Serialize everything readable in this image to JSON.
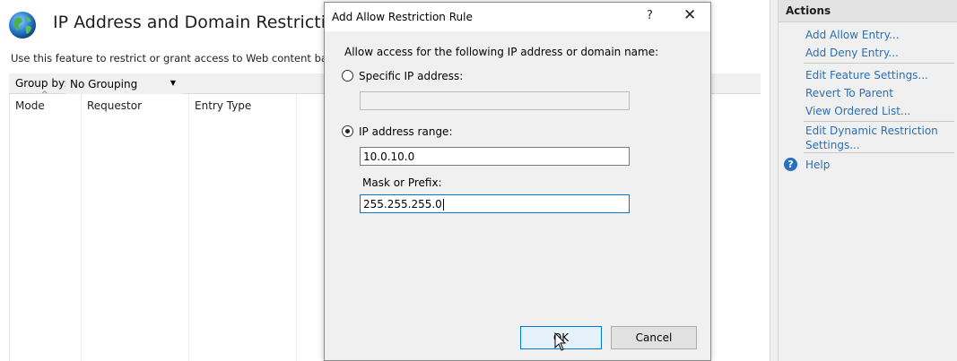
{
  "main": {
    "title": "IP Address and Domain Restrictions",
    "description": "Use this feature to restrict or grant access to Web content based on",
    "group_by_label": "Group by:",
    "group_by_value": "No Grouping",
    "columns": [
      "Mode",
      "Requestor",
      "Entry Type"
    ],
    "icons": {
      "feature": "globe-icon",
      "dropdown": "chevron-down-icon",
      "sort": "sort-ascending-icon"
    }
  },
  "actions": {
    "title": "Actions",
    "items": [
      "Add Allow Entry...",
      "Add Deny Entry...",
      "Edit Feature Settings...",
      "Revert To Parent",
      "View Ordered List...",
      "Edit Dynamic Restriction Settings...",
      "Help"
    ],
    "link_color": "#2a6fb6"
  },
  "dialog": {
    "title": "Add Allow Restriction Rule",
    "help_glyph": "?",
    "close_glyph": "✕",
    "intro": "Allow access for the following IP address or domain name:",
    "specific_ip_label": "Specific IP address:",
    "specific_ip_value": "",
    "ip_range_label": "IP address range:",
    "ip_range_value": "10.0.10.0",
    "mask_label": "Mask or Prefix:",
    "mask_value": "255.255.255.0",
    "selected_option": "IP address range",
    "ok_label": "OK",
    "cancel_label": "Cancel"
  }
}
